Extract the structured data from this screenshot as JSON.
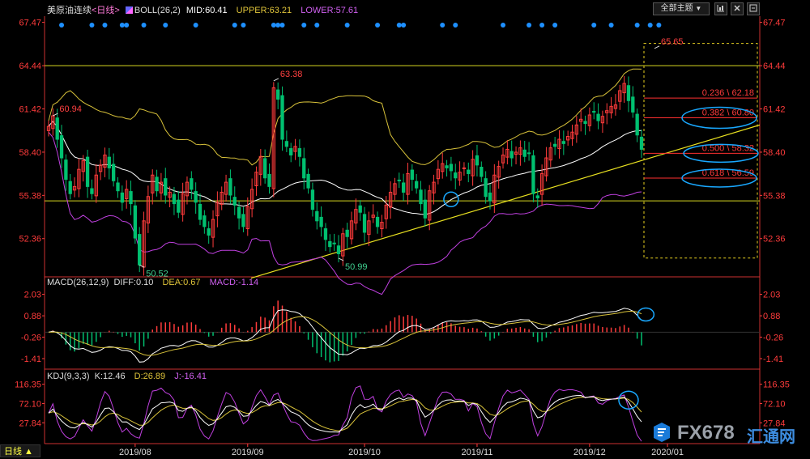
{
  "title": {
    "name": "美原油连续",
    "period": "<日线>"
  },
  "boll_header": {
    "label": "BOLL(26,2)",
    "mid": "MID:60.41",
    "upper": "UPPER:63.21",
    "lower": "LOWER:57.61"
  },
  "macd_header": {
    "label": "MACD(26,12,9)",
    "diff": "DIFF:0.10",
    "dea": "DEA:0.67",
    "macd": "MACD:-1.14"
  },
  "kdj_header": {
    "label": "KDJ(9,3,3)",
    "k": "K:12.46",
    "d": "D:26.89",
    "j": "J:-16.41"
  },
  "toolbar": {
    "dropdown": "全部主题",
    "dropdown_arrow": "▼"
  },
  "bottom_tab": "日线 ▲",
  "watermark": {
    "brand": "FX678",
    "cn": "汇通网"
  },
  "colors": {
    "up": "#ff3b3b",
    "down": "#00c070",
    "mid": "#ffffff",
    "upper": "#d8c23a",
    "lower": "#c040e0",
    "axis": "#ff3b3b"
  },
  "chart_data": [
    {
      "type": "candlestick",
      "title": "美原油连续 <日线> BOLL(26,2)",
      "yticks": [
        67.47,
        64.44,
        61.42,
        58.4,
        55.38,
        52.36
      ],
      "ylim": [
        49.8,
        67.9
      ],
      "xticks": [
        "2019/08",
        "2019/09",
        "2019/10",
        "2019/11",
        "2019/12",
        "2020/01"
      ],
      "close": [
        60.2,
        60.94,
        59.3,
        58.0,
        56.5,
        55.5,
        56.0,
        57.2,
        57.8,
        56.0,
        55.5,
        56.8,
        57.5,
        58.2,
        57.3,
        56.4,
        55.7,
        54.9,
        55.8,
        54.8,
        52.4,
        50.52,
        53.6,
        55.3,
        56.8,
        55.7,
        56.3,
        55.4,
        55.6,
        54.8,
        54.2,
        55.5,
        56.3,
        55.8,
        54.9,
        53.7,
        53.2,
        52.6,
        53.7,
        54.9,
        55.6,
        56.3,
        55.4,
        54.7,
        53.8,
        53.2,
        54.6,
        55.8,
        57.0,
        58.1,
        56.6,
        56.0,
        62.9,
        62.1,
        59.3,
        58.8,
        58.2,
        58.8,
        58.1,
        56.6,
        55.9,
        54.4,
        53.6,
        53.2,
        52.3,
        51.8,
        52.0,
        51.3,
        52.7,
        52.5,
        53.6,
        54.4,
        54.2,
        52.8,
        53.6,
        54.0,
        53.2,
        53.5,
        54.7,
        55.6,
        56.2,
        56.4,
        55.6,
        56.9,
        56.5,
        55.9,
        54.8,
        53.8,
        55.7,
        56.3,
        57.2,
        57.6,
        57.3,
        57.1,
        56.6,
        57.0,
        57.3,
        56.9,
        57.9,
        57.5,
        56.7,
        55.3,
        55.0,
        56.8,
        57.4,
        58.2,
        58.6,
        58.0,
        58.4,
        58.7,
        58.1,
        58.3,
        55.5,
        55.2,
        56.9,
        58.0,
        58.7,
        58.8,
        59.3,
        59.0,
        59.5,
        59.8,
        60.3,
        60.7,
        60.4,
        61.0,
        61.2,
        60.6,
        60.9,
        61.3,
        61.6,
        61.7,
        62.7,
        63.2,
        62.0,
        61.2,
        59.6,
        58.6
      ],
      "annotations": [
        {
          "text": "60.94",
          "value": 60.94
        },
        {
          "text": "50.52",
          "value": 50.52
        },
        {
          "text": "63.38",
          "value": 63.38
        },
        {
          "text": "50.99",
          "value": 50.99
        },
        {
          "text": "65.65",
          "value": 65.65
        }
      ],
      "horizontal_lines": [
        64.44,
        55.0
      ],
      "fibonacci": [
        {
          "label": "0.236 \\ 62.18",
          "value": 62.18
        },
        {
          "label": "0.382 \\ 60.80",
          "value": 60.8
        },
        {
          "label": "0.500 \\ 58.32",
          "value": 58.32
        },
        {
          "label": "0.618 \\ 56.59",
          "value": 56.59
        }
      ],
      "fib_range": [
        51.0,
        66.0
      ],
      "trendline": {
        "from": [
          0,
          49.6
        ],
        "to": [
          1,
          60.3
        ]
      },
      "bands": [
        "MID",
        "UPPER",
        "LOWER"
      ]
    },
    {
      "type": "bar",
      "title": "MACD(26,12,9)",
      "yticks": [
        2.03,
        0.88,
        -0.26,
        -1.41
      ],
      "ylim": [
        -1.8,
        2.4
      ],
      "series": [
        {
          "name": "DIFF",
          "last": 0.1
        },
        {
          "name": "DEA",
          "last": 0.67
        },
        {
          "name": "MACD",
          "last": -1.14
        }
      ]
    },
    {
      "type": "line",
      "title": "KDJ(9,3,3)",
      "yticks": [
        116.35,
        72.1,
        27.84
      ],
      "ylim": [
        -20,
        125
      ],
      "series": [
        {
          "name": "K",
          "last": 12.46
        },
        {
          "name": "D",
          "last": 26.89
        },
        {
          "name": "J",
          "last": -16.41
        }
      ]
    }
  ]
}
